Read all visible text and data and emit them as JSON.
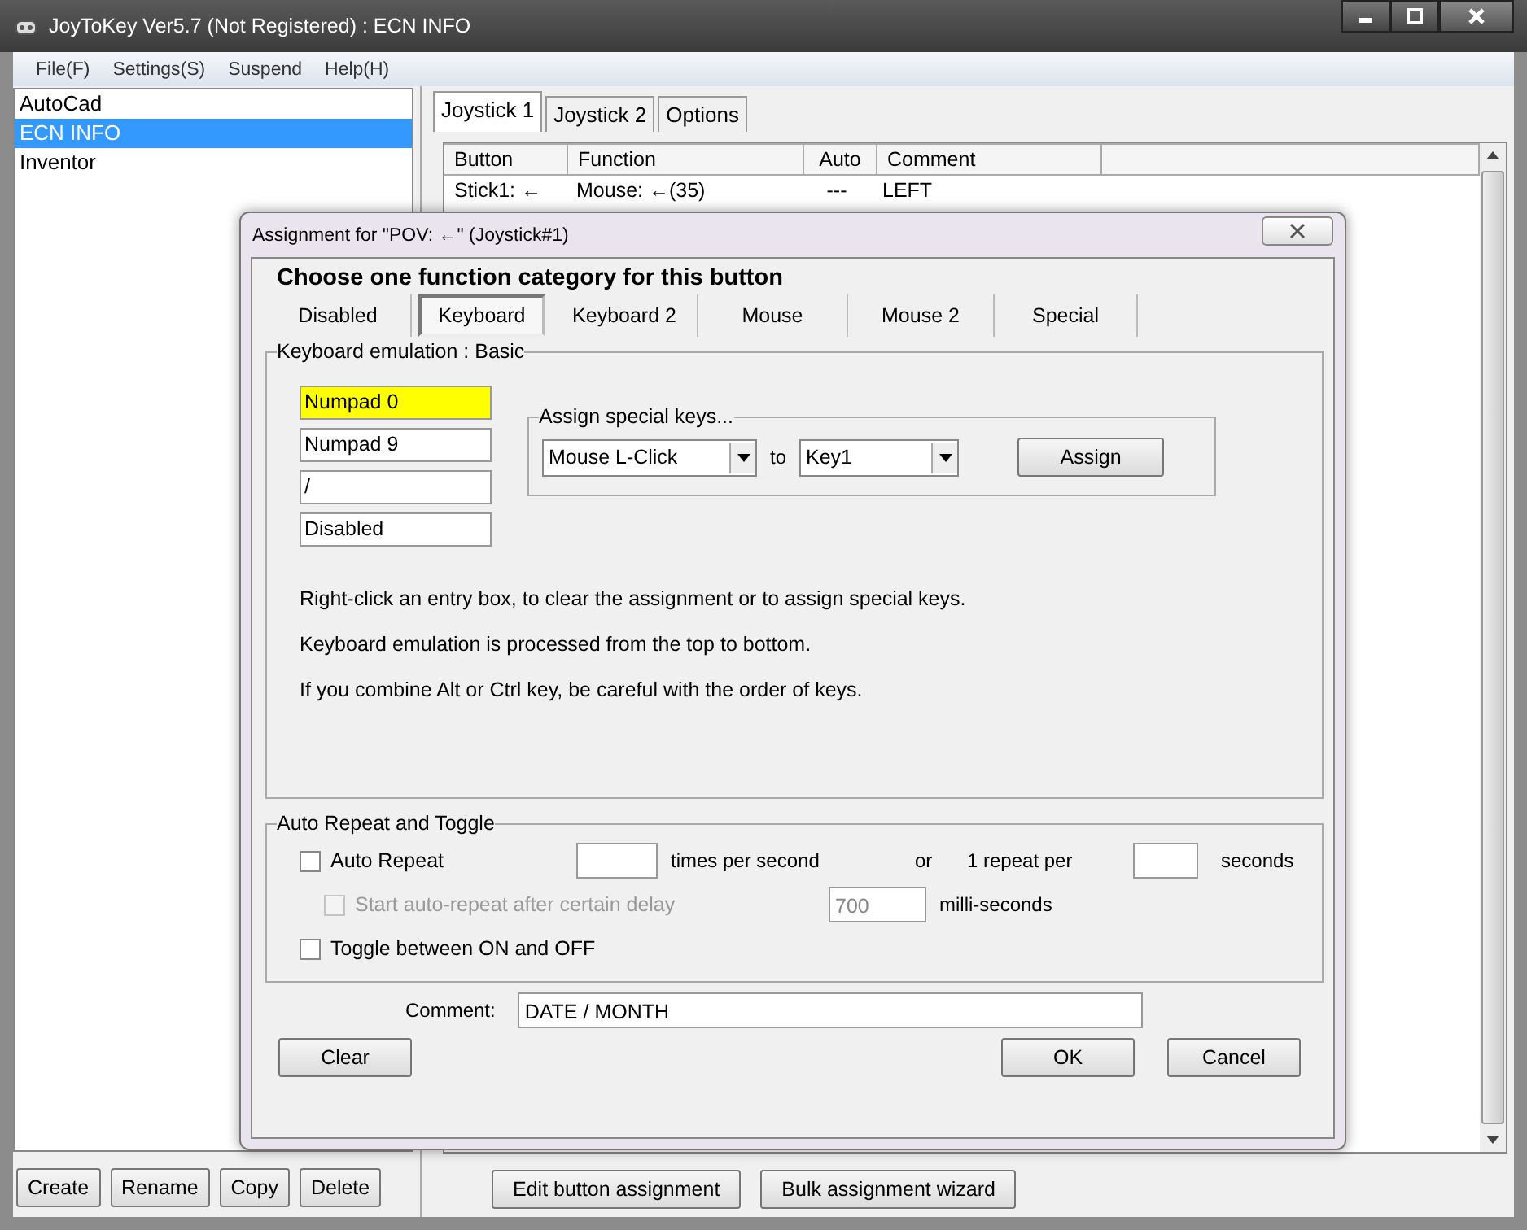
{
  "window": {
    "title": "JoyToKey Ver5.7 (Not Registered) : ECN INFO"
  },
  "menu": [
    "File(F)",
    "Settings(S)",
    "Suspend",
    "Help(H)"
  ],
  "profiles": [
    {
      "label": "AutoCad",
      "selected": false
    },
    {
      "label": "ECN INFO",
      "selected": true
    },
    {
      "label": "Inventor",
      "selected": false
    }
  ],
  "profile_buttons": [
    "Create",
    "Rename",
    "Copy",
    "Delete"
  ],
  "tabs": [
    {
      "label": "Joystick 1",
      "selected": true
    },
    {
      "label": "Joystick 2",
      "selected": false
    },
    {
      "label": "Options",
      "selected": false
    }
  ],
  "table": {
    "columns": [
      "Button",
      "Function",
      "Auto",
      "Comment"
    ],
    "rows": [
      [
        "Stick1: ←",
        "Mouse: ←(35)",
        "---",
        "LEFT"
      ]
    ]
  },
  "bottom_buttons": [
    "Edit button assignment",
    "Bulk assignment wizard"
  ],
  "dialog": {
    "title": "Assignment for \"POV: ←\" (Joystick#1)",
    "heading": "Choose one function category for this button",
    "categories": [
      {
        "label": "Disabled",
        "selected": false
      },
      {
        "label": "Keyboard",
        "selected": true
      },
      {
        "label": "Keyboard 2",
        "selected": false
      },
      {
        "label": "Mouse",
        "selected": false
      },
      {
        "label": "Mouse 2",
        "selected": false
      },
      {
        "label": "Special",
        "selected": false
      }
    ],
    "group_title": "Keyboard emulation : Basic",
    "keys": [
      {
        "value": "Numpad 0",
        "highlighted": true
      },
      {
        "value": "Numpad 9",
        "highlighted": false
      },
      {
        "value": "/",
        "highlighted": false
      },
      {
        "value": "Disabled",
        "highlighted": false
      }
    ],
    "special": {
      "title": "Assign special keys...",
      "from": "Mouse L-Click",
      "to_label": "to",
      "to": "Key1",
      "button": "Assign"
    },
    "notes": [
      "Right-click an entry box, to clear the assignment or to assign special keys.",
      "Keyboard emulation is processed from the top to bottom.",
      "If you combine Alt or Ctrl key, be careful with the order of keys."
    ],
    "repeat": {
      "title": "Auto Repeat and Toggle",
      "auto_repeat": {
        "label": "Auto Repeat",
        "checked": false
      },
      "rate_label": "times per second",
      "or_label": "or",
      "per_label": "1 repeat per",
      "seconds_label": "seconds",
      "delay": {
        "label": "Start auto-repeat after certain delay",
        "checked": false,
        "disabled": true,
        "value": "700",
        "unit": "milli-seconds"
      },
      "toggle": {
        "label": "Toggle between ON and OFF",
        "checked": false
      }
    },
    "comment_label": "Comment:",
    "comment": "DATE / MONTH",
    "buttons": [
      "Clear",
      "OK",
      "Cancel"
    ]
  }
}
